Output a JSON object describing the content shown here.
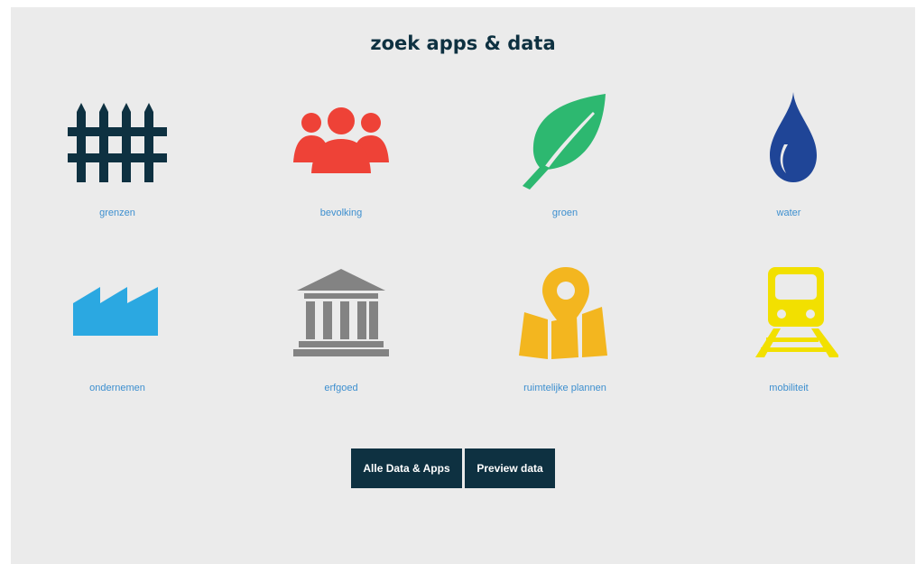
{
  "header": {
    "title": "zoek apps & data"
  },
  "categories": [
    {
      "label": "grenzen",
      "icon": "fence-icon",
      "color": "#0e3141"
    },
    {
      "label": "bevolking",
      "icon": "people-icon",
      "color": "#ee4237"
    },
    {
      "label": "groen",
      "icon": "leaf-icon",
      "color": "#2db870"
    },
    {
      "label": "water",
      "icon": "water-drop-icon",
      "color": "#1f4597"
    },
    {
      "label": "ondernemen",
      "icon": "factory-icon",
      "color": "#2ba8e1"
    },
    {
      "label": "erfgoed",
      "icon": "monument-icon",
      "color": "#838383"
    },
    {
      "label": "ruimtelijke plannen",
      "icon": "map-pin-icon",
      "color": "#f3b61f"
    },
    {
      "label": "mobiliteit",
      "icon": "train-icon",
      "color": "#f2e000"
    }
  ],
  "buttons": {
    "all": "Alle Data & Apps",
    "preview": "Preview data"
  },
  "colors": {
    "label": "#3d8fcf",
    "button_bg": "#0e3141",
    "panel_bg": "#ebebeb"
  }
}
